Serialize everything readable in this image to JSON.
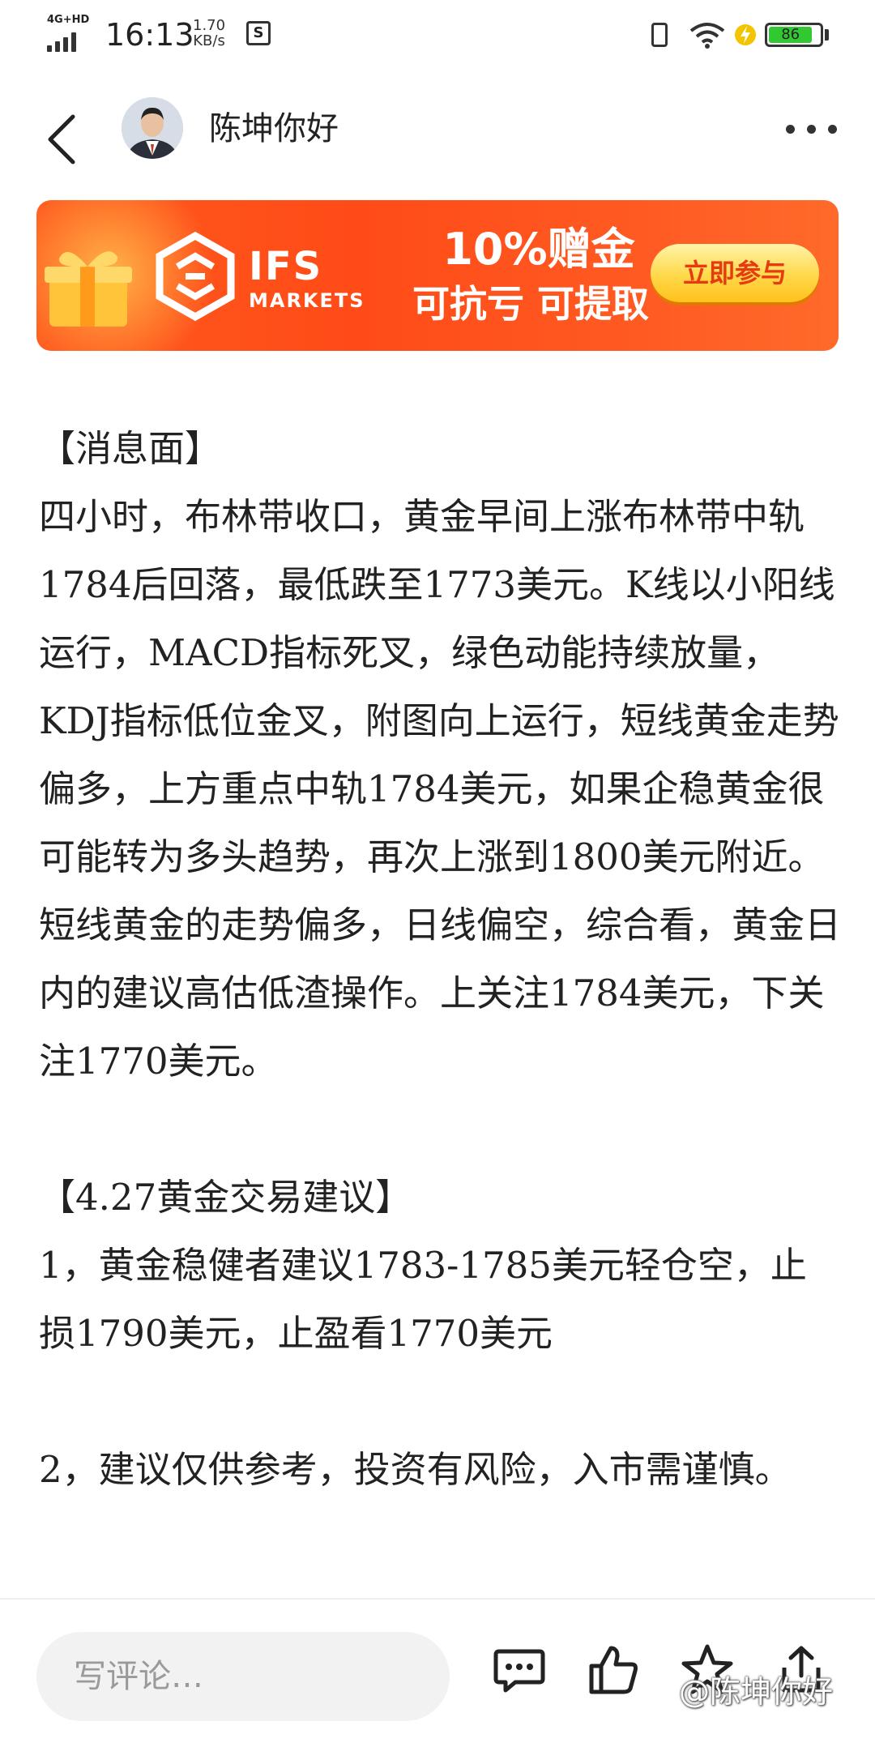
{
  "status_bar": {
    "network": "4G+HD",
    "time": "16:13",
    "speed_value": "1.70",
    "speed_unit": "KB/s",
    "battery": "86"
  },
  "header": {
    "author_name": "陈坤你好"
  },
  "banner": {
    "logo_name": "IFS",
    "logo_sub": "MARKETS",
    "promo_line1": "10%赠金",
    "promo_line2": "可抗亏 可提取",
    "cta_label": "立即参与",
    "colors": {
      "bg": "#ff4b17",
      "cta": "#ffd84a",
      "cta_text": "#e83a10"
    }
  },
  "article": {
    "p1": "【消息面】",
    "p2": "四小时，布林带收口，黄金早间上涨布林带中轨1784后回落，最低跌至1773美元。K线以小阳线运行，MACD指标死叉，绿色动能持续放量，KDJ指标低位金叉，附图向上运行，短线黄金走势偏多，上方重点中轨1784美元，如果企稳黄金很可能转为多头趋势，再次上涨到1800美元附近。短线黄金的走势偏多，日线偏空，综合看，黄金日内的建议高估低渣操作。上关注1784美元，下关注1770美元。",
    "p3": "【4.27黄金交易建议】",
    "p4": "1，黄金稳健者建议1783-1785美元轻仓空，止损1790美元，止盈看1770美元",
    "p5": "2，建议仅供参考，投资有风险，入市需谨慎。"
  },
  "bottom_bar": {
    "comment_placeholder": "写评论…",
    "icons": [
      "comment-icon",
      "like-icon",
      "favorite-icon",
      "share-icon"
    ],
    "watermark": "@陈坤你好"
  }
}
